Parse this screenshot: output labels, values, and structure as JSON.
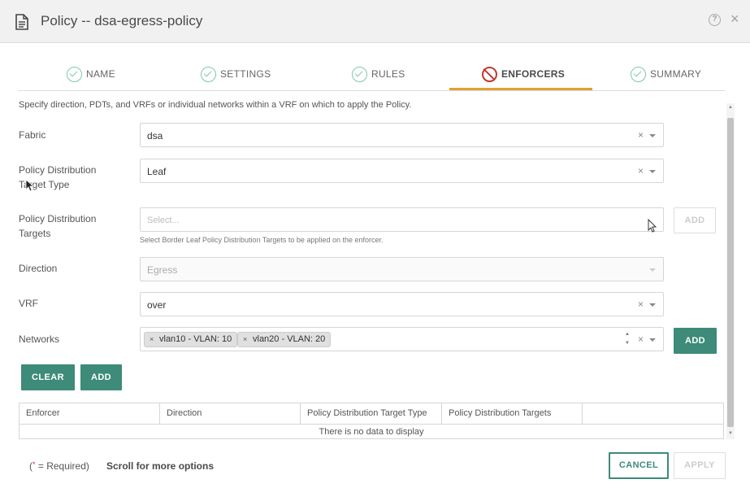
{
  "header": {
    "title": "Policy -- dsa-egress-policy",
    "help_glyph": "?",
    "close_glyph": "×"
  },
  "stepper": {
    "steps": [
      {
        "label": "NAME",
        "state": "complete"
      },
      {
        "label": "SETTINGS",
        "state": "complete"
      },
      {
        "label": "RULES",
        "state": "complete"
      },
      {
        "label": "ENFORCERS",
        "state": "active"
      },
      {
        "label": "SUMMARY",
        "state": "complete"
      }
    ],
    "active_color": "#e0a030",
    "complete_color": "#7ec6b3",
    "error_color": "#c0392b"
  },
  "form": {
    "description": "Specify direction, PDTs, and VRFs or individual networks within a VRF on which to apply the Policy.",
    "fabric": {
      "label": "Fabric",
      "value": "dsa"
    },
    "pdt_type": {
      "label_line1": "Policy Distribution",
      "label_line2": "Target Type",
      "value": "Leaf"
    },
    "pdt_targets": {
      "label_line1": "Policy Distribution",
      "label_line2": "Targets",
      "placeholder": "Select...",
      "hint": "Select Border Leaf Policy Distribution Targets to be applied on the enforcer.",
      "add_label": "ADD"
    },
    "direction": {
      "label": "Direction",
      "value": "Egress"
    },
    "vrf": {
      "label": "VRF",
      "value": "over"
    },
    "networks": {
      "label": "Networks",
      "tags": [
        "vlan10 - VLAN: 10",
        "vlan20 - VLAN: 20"
      ],
      "add_label": "ADD"
    },
    "clear_glyph": "×",
    "spin_up": "▲",
    "spin_down": "▼"
  },
  "actions": {
    "clear_label": "CLEAR",
    "add_label": "ADD"
  },
  "table": {
    "columns": [
      "Enforcer",
      "Direction",
      "Policy Distribution Target Type",
      "Policy Distribution Targets",
      ""
    ],
    "empty_text": "There is no data to display"
  },
  "scrollbar": {
    "up_glyph": "▲",
    "down_glyph": "▼"
  },
  "footer": {
    "required_prefix": "(",
    "required_star": "*",
    "required_suffix": " = Required)",
    "scroll_hint": "Scroll for more options",
    "cancel_label": "CANCEL",
    "apply_label": "APPLY"
  },
  "colors": {
    "primary": "#3d8b78",
    "header_bg": "#f1f1f1"
  }
}
